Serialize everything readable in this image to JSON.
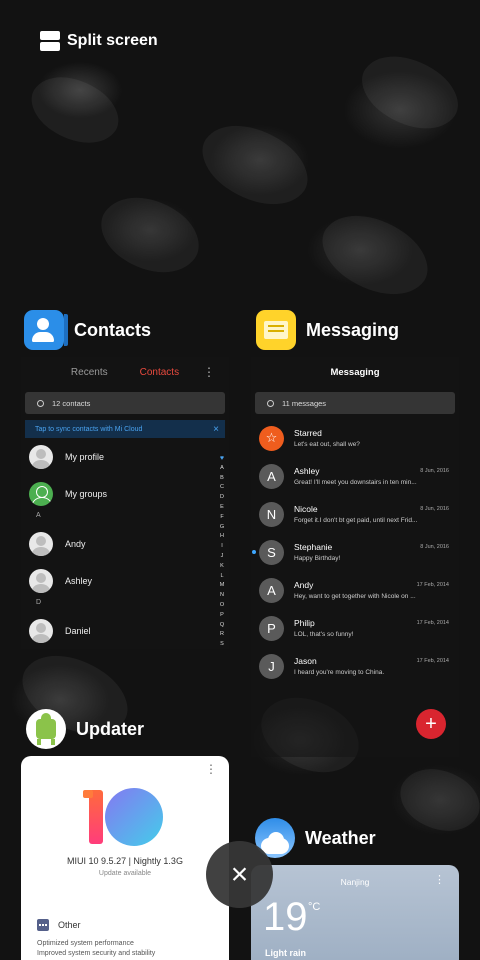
{
  "split_screen": {
    "label": "Split screen"
  },
  "contacts": {
    "app_label": "Contacts",
    "tabs": [
      "Recents",
      "Contacts"
    ],
    "more_icon": "⋮",
    "search_placeholder": "12 contacts",
    "banner": "Tap to sync contacts with Mi Cloud",
    "banner_close": "×",
    "rows": [
      {
        "name": "My profile",
        "type": "profile"
      },
      {
        "name": "My groups",
        "type": "groups"
      }
    ],
    "section_a": "A",
    "a_rows": [
      "Andy",
      "Ashley"
    ],
    "section_d": "D",
    "d_rows": [
      "Daniel"
    ],
    "alphabet": [
      "♥",
      "A",
      "B",
      "C",
      "D",
      "E",
      "F",
      "G",
      "H",
      "I",
      "J",
      "K",
      "L",
      "M",
      "N",
      "O",
      "P",
      "Q",
      "R",
      "S"
    ]
  },
  "messaging": {
    "app_label": "Messaging",
    "title": "Messaging",
    "search_placeholder": "11 messages",
    "threads": [
      {
        "initial": "☆",
        "name": "Starred",
        "preview": "Let's eat out, shall we?",
        "date": "",
        "star": true,
        "unread": false
      },
      {
        "initial": "A",
        "name": "Ashley",
        "preview": "Great! I'll meet you downstairs in ten min...",
        "date": "8 Jun, 2016",
        "star": false,
        "unread": false
      },
      {
        "initial": "N",
        "name": "Nicole",
        "preview": "Forget it.I don't bt get paid, until next Frid...",
        "date": "8 Jun, 2016",
        "star": false,
        "unread": false
      },
      {
        "initial": "S",
        "name": "Stephanie",
        "preview": "Happy Birthday!",
        "date": "8 Jun, 2016",
        "star": false,
        "unread": true
      },
      {
        "initial": "A",
        "name": "Andy",
        "preview": "Hey, want to get together with Nicole on ...",
        "date": "17 Feb, 2014",
        "star": false,
        "unread": false
      },
      {
        "initial": "P",
        "name": "Philip",
        "preview": "LOL, that's so funny!",
        "date": "17 Feb, 2014",
        "star": false,
        "unread": false
      },
      {
        "initial": "J",
        "name": "Jason",
        "preview": "I heard you're moving to China.",
        "date": "17 Feb, 2014",
        "star": false,
        "unread": false
      }
    ],
    "fab": "+"
  },
  "updater": {
    "app_label": "Updater",
    "version": "MIUI 10 9.5.27 | Nightly 1.3G",
    "status": "Update available",
    "section": "Other",
    "notes": [
      "Optimized system performance",
      "Improved system security and stability"
    ]
  },
  "weather": {
    "app_label": "Weather",
    "city": "Nanjing",
    "temp": "19",
    "unit": "°C",
    "condition": "Light rain"
  },
  "close": {
    "label": "×"
  }
}
